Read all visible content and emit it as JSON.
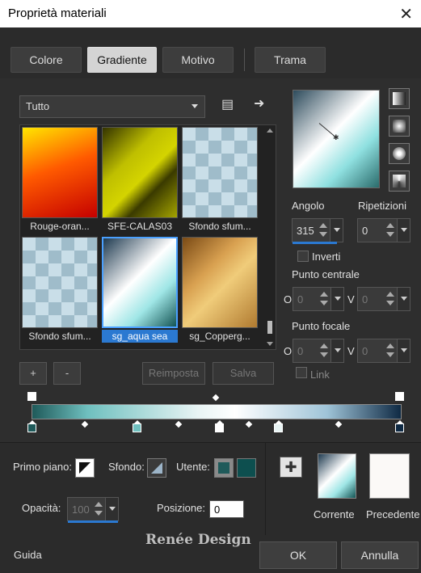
{
  "title": "Proprietà materiali",
  "tabs": [
    {
      "label": "Colore"
    },
    {
      "label": "Gradiente"
    },
    {
      "label": "Motivo"
    },
    {
      "label": "Trama"
    }
  ],
  "category": "Tutto",
  "gallery": {
    "items": [
      {
        "label": "Rouge-oran..."
      },
      {
        "label": "SFE-CALAS03"
      },
      {
        "label": "Sfondo sfum..."
      },
      {
        "label": "Sfondo sfum..."
      },
      {
        "label": "sg_aqua sea"
      },
      {
        "label": "sg_Copperg..."
      }
    ]
  },
  "buttons": {
    "add": "+",
    "remove": "-",
    "reset": "Reimposta",
    "save": "Salva"
  },
  "angle": {
    "label": "Angolo",
    "value": "315"
  },
  "repeats": {
    "label": "Ripetizioni",
    "value": "0"
  },
  "invert": {
    "label": "Inverti"
  },
  "center": {
    "label": "Punto centrale",
    "o_label": "O",
    "o_value": "0",
    "v_label": "V",
    "v_value": "0"
  },
  "focal": {
    "label": "Punto focale",
    "o_label": "O",
    "o_value": "0",
    "v_label": "V",
    "v_value": "0"
  },
  "link": {
    "label": "Link"
  },
  "foreground": {
    "label": "Primo piano:"
  },
  "background": {
    "label": "Sfondo:"
  },
  "user": {
    "label": "Utente:"
  },
  "opacity": {
    "label": "Opacità:",
    "value": "100"
  },
  "position": {
    "label": "Posizione:",
    "value": "0"
  },
  "current": {
    "label": "Corrente"
  },
  "previous": {
    "label": "Precedente"
  },
  "guide": {
    "label": "Guida"
  },
  "ok": {
    "label": "OK"
  },
  "cancel": {
    "label": "Annulla"
  },
  "watermark": "Renée Design",
  "colors": {
    "accent": "#2b79d1",
    "teal": "#1f5a5a",
    "navy": "#0f2a44"
  }
}
